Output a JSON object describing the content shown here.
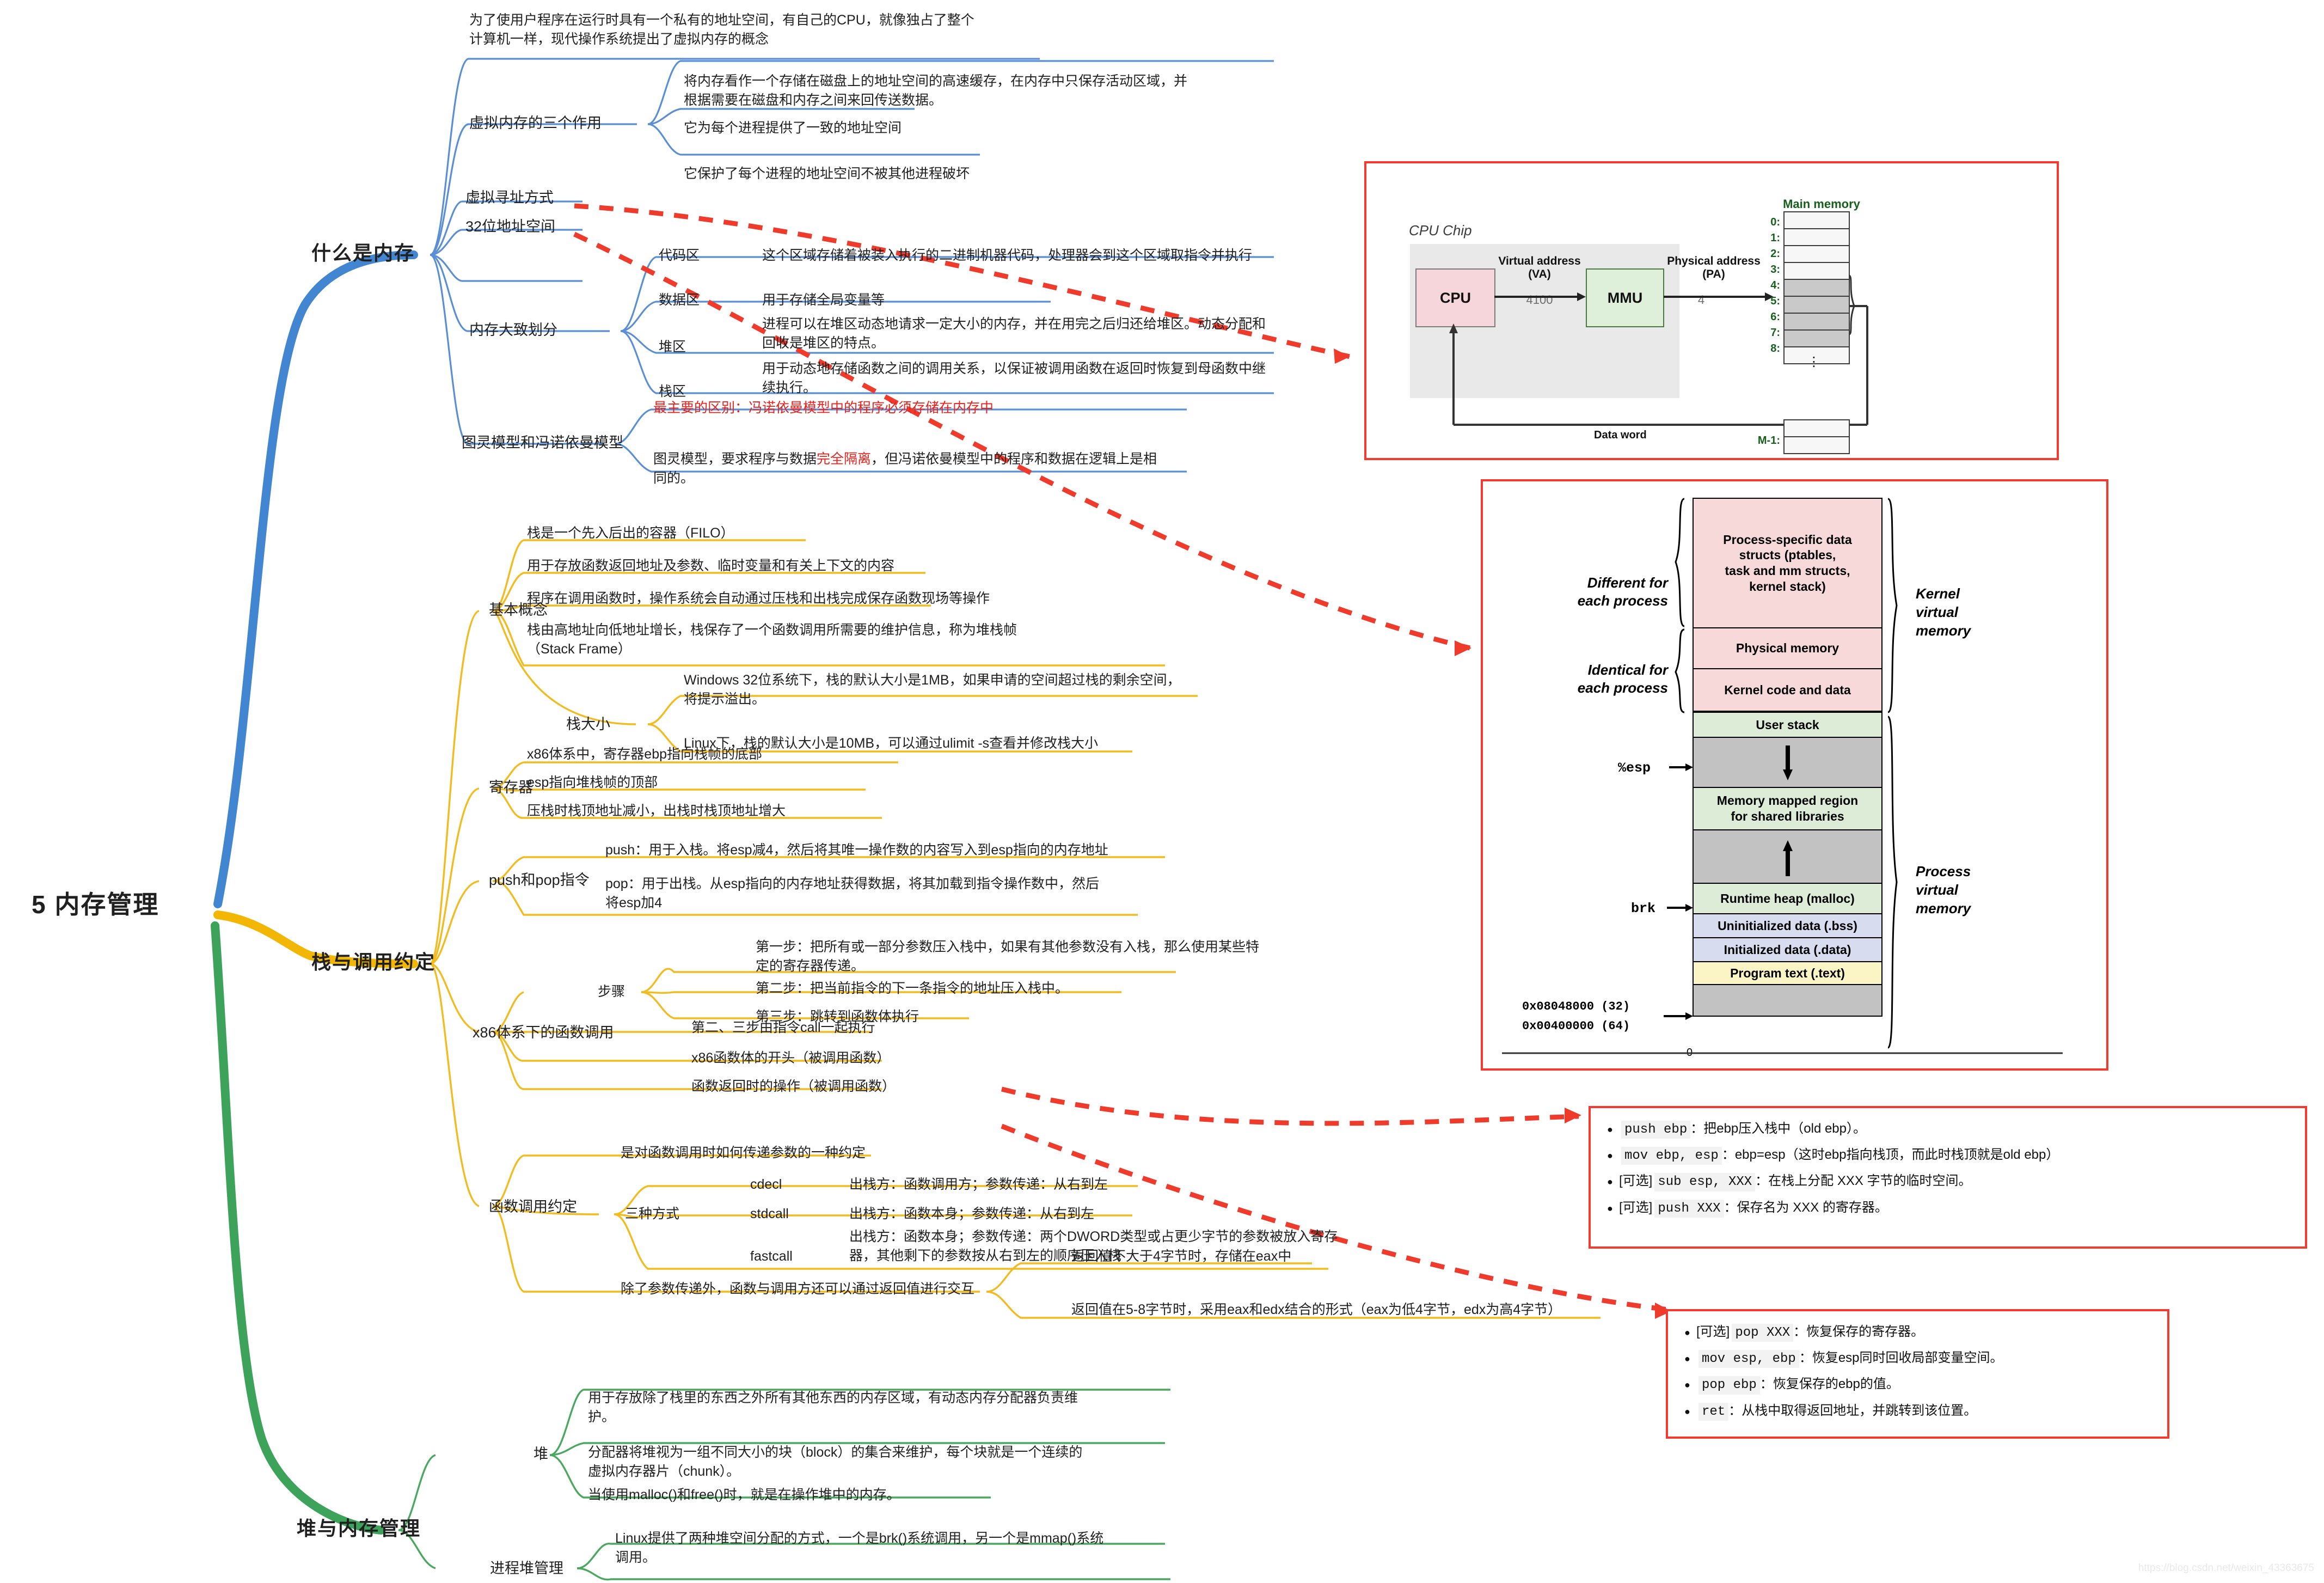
{
  "root": {
    "label": "5 内存管理"
  },
  "branches": [
    {
      "label": "什么是内存",
      "color": "#4285d1"
    },
    {
      "label": "栈与调用约定",
      "color": "#f2b705"
    },
    {
      "label": "堆与内存管理",
      "color": "#3da35a"
    }
  ],
  "memory_branch": {
    "intro": "为了使用户程序在运行时具有一个私有的地址空间，有自己的CPU，就像独占了整个\n计算机一样，现代操作系统提出了虚拟内存的概念",
    "three_roles_label": "虚拟内存的三个作用",
    "three_roles": [
      "将内存看作一个存储在磁盘上的地址空间的高速缓存，在内存中只保存活动区域，并\n根据需要在磁盘和内存之间来回传送数据。",
      "它为每个进程提供了一致的地址空间",
      "它保护了每个进程的地址空间不被其他进程破坏"
    ],
    "virtual_addressing": "虚拟寻址方式",
    "addr_space_32": "32位地址空间",
    "partition_label": "内存大致划分",
    "partitions": [
      {
        "name": "代码区",
        "desc": "这个区域存储着被装入执行的二进制机器代码，处理器会到这个区域取指令并执行"
      },
      {
        "name": "数据区",
        "desc": "用于存储全局变量等"
      },
      {
        "name": "堆区",
        "desc": "进程可以在堆区动态地请求一定大小的内存，并在用完之后归还给堆区。动态分配和\n回收是堆区的特点。"
      },
      {
        "name": "栈区",
        "desc": "用于动态地存储函数之间的调用关系，以保证被调用函数在返回时恢复到母函数中继\n续执行。"
      }
    ],
    "turing_label": "图灵模型和冯诺依曼模型",
    "turing_red": "最主要的区别：冯诺依曼模型中的程序必须存储在内存中",
    "turing_desc_a": "图灵模型，要求程序与数据",
    "turing_desc_red": "完全隔离",
    "turing_desc_b": "，但冯诺依曼模型中的程序和数据在逻辑上是相\n同的。"
  },
  "stack_branch": {
    "basic_label": "基本概念",
    "basics": [
      "栈是一个先入后出的容器（FILO）",
      "用于存放函数返回地址及参数、临时变量和有关上下文的内容",
      "程序在调用函数时，操作系统会自动通过压栈和出栈完成保存函数现场等操作",
      "栈由高地址向低地址增长，栈保存了一个函数调用所需要的维护信息，称为堆栈帧\n（Stack Frame）"
    ],
    "size_label": "栈大小",
    "sizes": [
      "Windows 32位系统下，栈的默认大小是1MB，如果申请的空间超过栈的剩余空间，\n将提示溢出。",
      "Linux下，栈的默认大小是10MB，可以通过ulimit -s查看并修改栈大小"
    ],
    "register_label": "寄存器",
    "registers": [
      "x86体系中，寄存器ebp指向栈帧的底部",
      "esp指向堆栈帧的顶部",
      "压栈时栈顶地址减小，出栈时栈顶地址增大"
    ],
    "pushpop_label": "push和pop指令",
    "pushpop": [
      "push：用于入栈。将esp减4，然后将其唯一操作数的内容写入到esp指向的内存地址",
      "pop：用于出栈。从esp指向的内存地址获得数据，将其加载到指令操作数中，然后\n将esp加4"
    ],
    "callconv_label": "x86体系下的函数调用",
    "steps_label": "步骤",
    "steps": [
      "第一步：把所有或一部分参数压入栈中，如果有其他参数没有入栈，那么使用某些特\n定的寄存器传递。",
      "第二步：把当前指令的下一条指令的地址压入栈中。",
      "第三步：跳转到函数体执行"
    ],
    "call_note": "第二、三步由指令call一起执行",
    "prologue": "x86函数体的开头（被调用函数）",
    "epilogue": "函数返回时的操作（被调用函数）",
    "conv_label": "函数调用约定",
    "conv_intro": "是对函数调用时如何传递参数的一种约定",
    "three_ways_label": "三种方式",
    "three_ways": [
      {
        "name": "cdecl",
        "desc": "出栈方：函数调用方；参数传递：从右到左"
      },
      {
        "name": "stdcall",
        "desc": "出栈方：函数本身；参数传递：从右到左"
      },
      {
        "name": "fastcall",
        "desc": "出栈方：函数本身；参数传递：两个DWORD类型或占更少字节的参数被放入寄存\n器，其他剩下的参数按从右到左的顺序压入栈"
      }
    ],
    "return_intro": "除了参数传递外，函数与调用方还可以通过返回值进行交互",
    "returns": [
      "返回值不大于4字节时，存储在eax中",
      "返回值在5-8字节时，采用eax和edx结合的形式（eax为低4字节，edx为高4字节）"
    ]
  },
  "heap_branch": {
    "heap_label": "堆",
    "heap_items": [
      "用于存放除了栈里的东西之外所有其他东西的内存区域，有动态内存分配器负责维\n护。",
      "分配器将堆视为一组不同大小的块（block）的集合来维护，每个块就是一个连续的\n虚拟内存器片（chunk）。",
      "当使用malloc()和free()时，就是在操作堆中的内存。"
    ],
    "proc_heap_label": "进程堆管理",
    "proc_heap_item": "Linux提供了两种堆空间分配的方式，一个是brk()系统调用，另一个是mmap()系统\n调用。"
  },
  "figure_cpu": {
    "chip_label": "CPU Chip",
    "cpu": "CPU",
    "mmu": "MMU",
    "va_label": "Virtual address\n(VA)",
    "va_value": "4100",
    "pa_label": "Physical address\n(PA)",
    "pa_value": "4",
    "main_memory": "Main memory",
    "indices": [
      "0:",
      "1:",
      "2:",
      "3:",
      "4:",
      "5:",
      "6:",
      "7:",
      "8:"
    ],
    "tail_index": "M-1:",
    "dots": "⋮",
    "data_word": "Data word"
  },
  "figure_vm": {
    "left_labels": [
      "Different for\neach process",
      "Identical  for\neach process"
    ],
    "right_labels": [
      "Kernel\nvirtual\nmemory",
      "Process\nvirtual\nmemory"
    ],
    "rows": [
      "Process-specific data\nstructs  (ptables,\ntask and mm structs,\nkernel stack)",
      "Physical memory",
      "Kernel code and data",
      "User stack",
      "",
      "Memory mapped region\nfor shared libraries",
      "",
      "Runtime heap (malloc)",
      "Uninitialized data (.bss)",
      "Initialized data (.data)",
      "Program text (.text)",
      ""
    ],
    "esp": "%esp",
    "brk": "brk",
    "addr32": "0x08048000  (32)",
    "addr64": "0x00400000  (64)",
    "zero": "0"
  },
  "callout_prologue": {
    "lines": [
      {
        "opt": "",
        "code": "push ebp",
        "text": "：把ebp压入栈中（old ebp）。"
      },
      {
        "opt": "",
        "code": "mov ebp, esp",
        "text": "：ebp=esp（这时ebp指向栈顶，而此时栈顶就是old ebp）"
      },
      {
        "opt": "[可选]",
        "code": "sub esp, XXX",
        "text": "：在栈上分配 XXX 字节的临时空间。"
      },
      {
        "opt": "[可选]",
        "code": "push XXX",
        "text": "：保存名为 XXX 的寄存器。"
      }
    ]
  },
  "callout_epilogue": {
    "lines": [
      {
        "opt": "[可选]",
        "code": "pop XXX",
        "text": "：恢复保存的寄存器。"
      },
      {
        "opt": "",
        "code": "mov esp, ebp",
        "text": "：恢复esp同时回收局部变量空间。"
      },
      {
        "opt": "",
        "code": "pop ebp",
        "text": "：恢复保存的ebp的值。"
      },
      {
        "opt": "",
        "code": "ret",
        "text": "：从栈中取得返回地址，并跳转到该位置。"
      }
    ]
  },
  "watermark": "https://blog.csdn.net/weixin_43363675"
}
